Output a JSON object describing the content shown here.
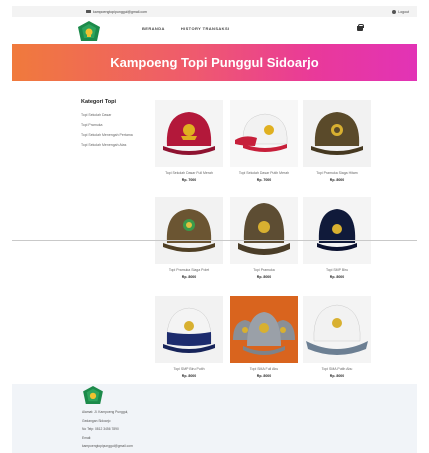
{
  "topbar": {
    "email": "kampoengtopipunggul@gmail.com",
    "logout_label": "Logout"
  },
  "navbar": {
    "links": [
      "BERANDA",
      "HISTORY TRANSAKSI"
    ]
  },
  "banner": {
    "title": "Kampoeng Topi Punggul Sidoarjo"
  },
  "sidebar": {
    "title": "Kategori Topi",
    "items": [
      "Topi Sekolah Dasar",
      "Topi Pramuka",
      "Topi Sekolah Menengah Pertama",
      "Topi Sekolah Menengah Atas"
    ]
  },
  "products": [
    {
      "caption": "Topi Sekolah Dasar Full Merah",
      "price": "Rp. 7000"
    },
    {
      "caption": "Topi Sekolah Dasar Putih Merah",
      "price": "Rp. 7000"
    },
    {
      "caption": "Topi Pramuka Siaga Hitam",
      "price": "Rp. 8000"
    },
    {
      "caption": "Topi Pramuka Siaga Polet",
      "price": "Rp. 8000"
    },
    {
      "caption": "Topi Pramuka",
      "price": "Rp. 8000"
    },
    {
      "caption": "Topi SMP Biru",
      "price": "Rp. 8000"
    },
    {
      "caption": "Topi SMP Biru Putih",
      "price": "Rp. 8000"
    },
    {
      "caption": "Topi SMA Full Abu",
      "price": "Rp. 8000"
    },
    {
      "caption": "Topi SMA Putih Abu",
      "price": "Rp. 8000"
    }
  ],
  "footer": {
    "lines": [
      "Alamat: Jl. Kampoeng Punggul,",
      "Gedangan Sidoarjo",
      "No Telp: 0812 3456 7890",
      "Email:",
      "kampoengtopipunggul@gmail.com"
    ]
  },
  "colors": {
    "banner_start": "#f07a3c",
    "banner_end": "#e233b6",
    "logo_green": "#1c8a4a"
  }
}
